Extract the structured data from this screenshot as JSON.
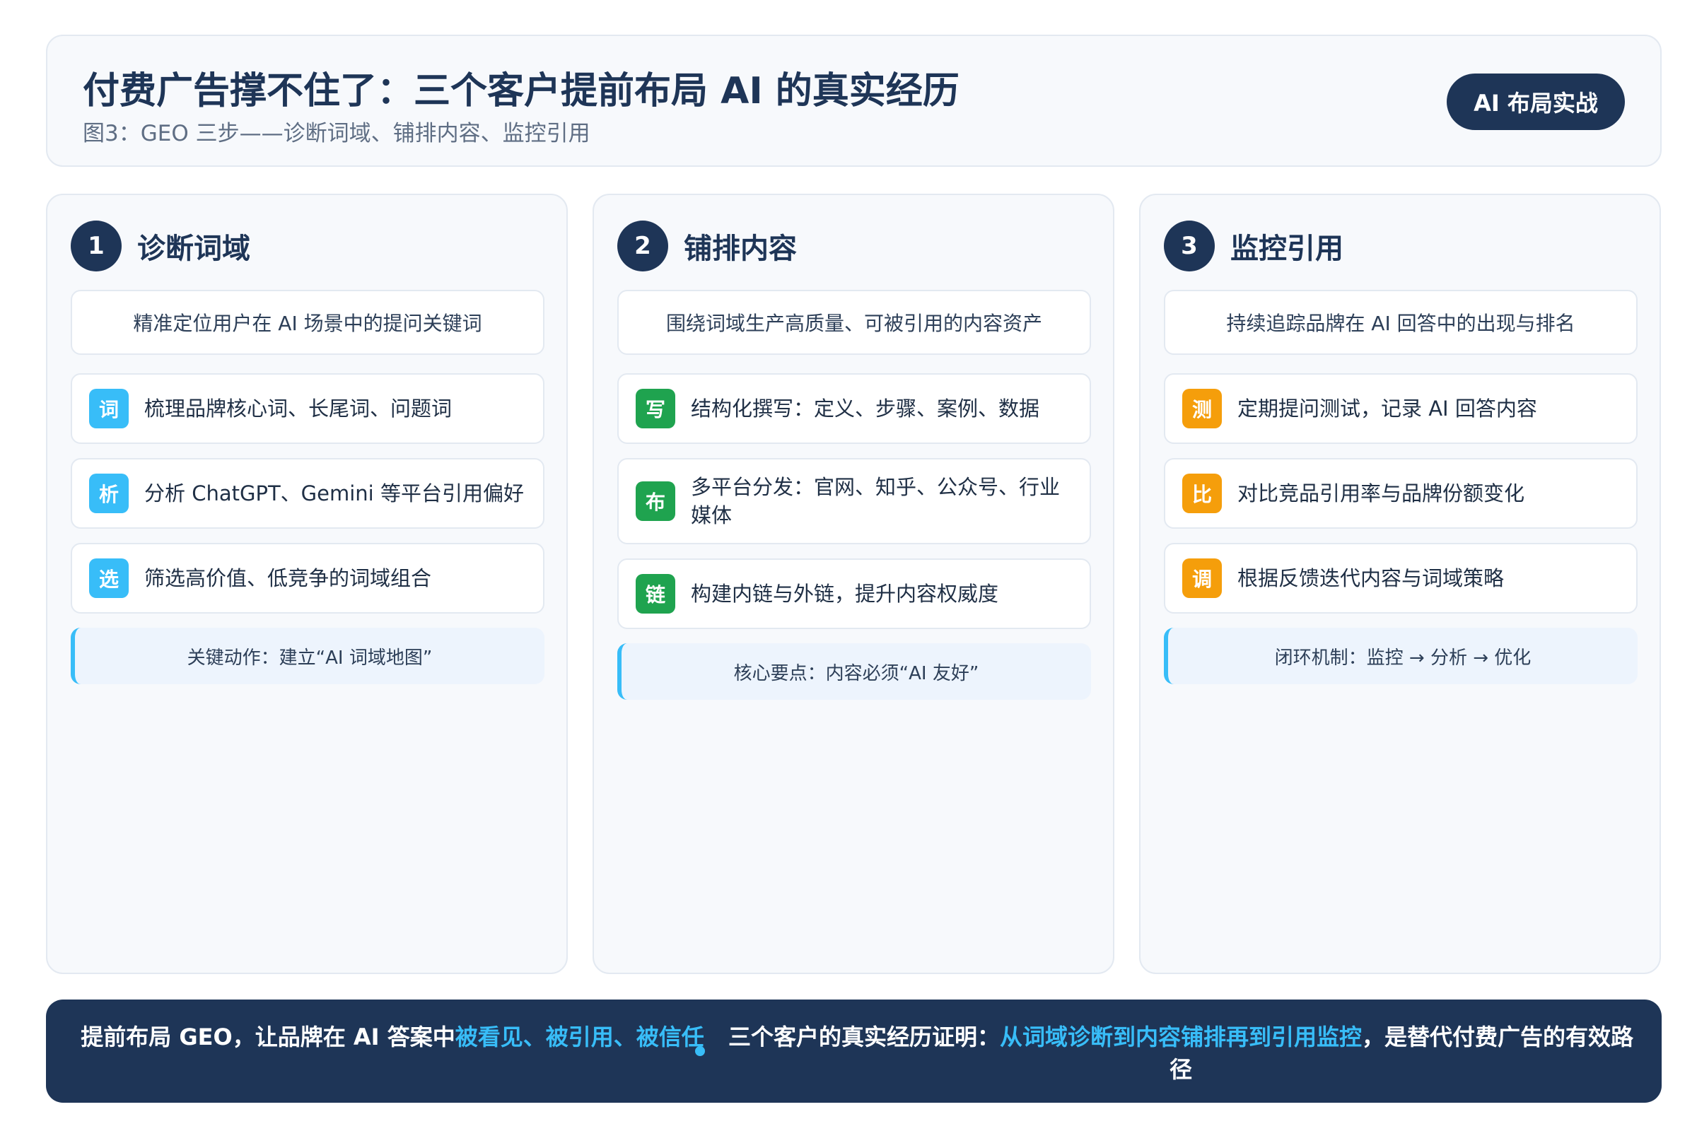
{
  "header": {
    "title": "付费广告撑不住了：三个客户提前布局 AI 的真实经历",
    "subtitle": "图3：GEO 三步——诊断词域、铺排内容、监控引用",
    "badge": "AI 布局实战"
  },
  "columns": [
    {
      "number": "1",
      "title": "诊断词域",
      "description": "精准定位用户在 AI 场景中的提问关键词",
      "items": [
        {
          "chip": "词",
          "text": "梳理品牌核心词、长尾词、问题词"
        },
        {
          "chip": "析",
          "text": "分析 ChatGPT、Gemini 等平台引用偏好"
        },
        {
          "chip": "选",
          "text": "筛选高价值、低竞争的词域组合"
        }
      ],
      "note": "关键动作：建立“AI 词域地图”"
    },
    {
      "number": "2",
      "title": "铺排内容",
      "description": "围绕词域生产高质量、可被引用的内容资产",
      "items": [
        {
          "chip": "写",
          "text": "结构化撰写：定义、步骤、案例、数据"
        },
        {
          "chip": "布",
          "text": "多平台分发：官网、知乎、公众号、行业媒体"
        },
        {
          "chip": "链",
          "text": "构建内链与外链，提升内容权威度"
        }
      ],
      "note": "核心要点：内容必须“AI 友好”"
    },
    {
      "number": "3",
      "title": "监控引用",
      "description": "持续追踪品牌在 AI 回答中的出现与排名",
      "items": [
        {
          "chip": "测",
          "text": "定期提问测试，记录 AI 回答内容"
        },
        {
          "chip": "比",
          "text": "对比竞品引用率与品牌份额变化"
        },
        {
          "chip": "调",
          "text": "根据反馈迭代内容与词域策略"
        }
      ],
      "note": "闭环机制：监控 → 分析 → 优化"
    }
  ],
  "footer": {
    "left_prefix": "提前布局 GEO，让品牌在 AI 答案中",
    "left_highlight": "被看见、被引用、被信任",
    "right_prefix": "三个客户的真实经历证明：",
    "right_highlight": "从词域诊断到内容铺排再到引用监控",
    "right_suffix": "，是替代付费广告的有效路径"
  },
  "colors": {
    "navy": "#1e3557",
    "accent_blue": "#38bdf8",
    "green": "#1fa34f",
    "orange": "#f59e0b",
    "panel_bg": "#f7f9fc",
    "note_bg": "#edf4fd"
  }
}
